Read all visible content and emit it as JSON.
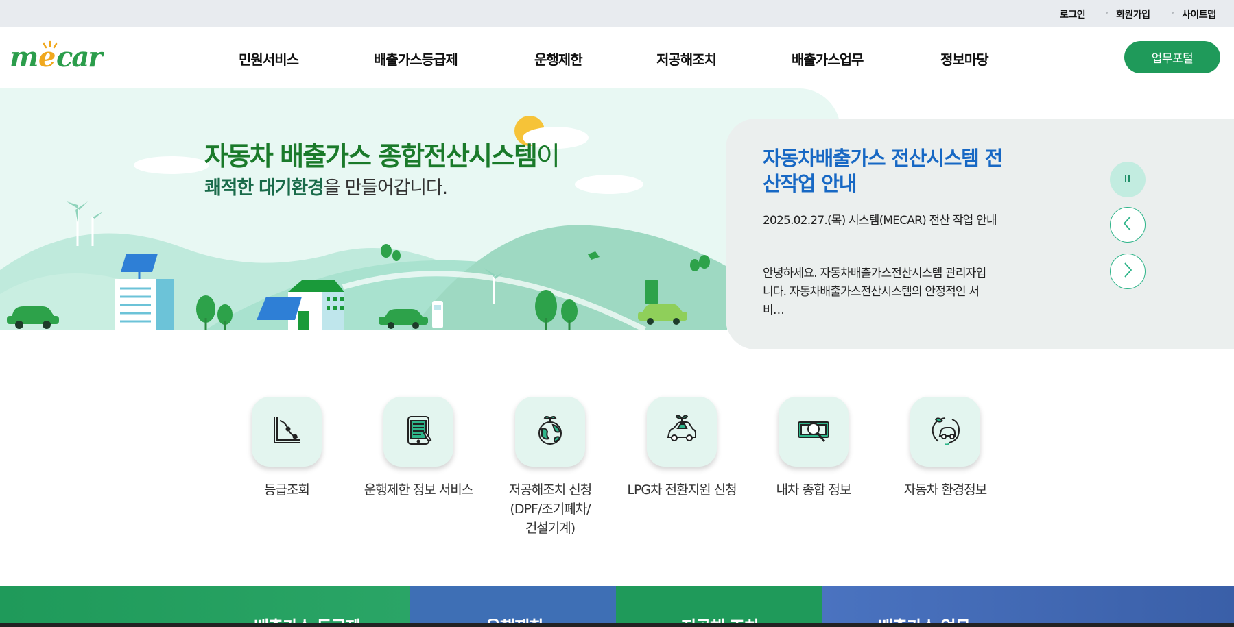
{
  "utility_nav": {
    "login": "로그인",
    "signup": "회원가입",
    "sitemap": "사이트맵"
  },
  "logo": {
    "text": "mecar"
  },
  "gnb": {
    "items": [
      {
        "label": "민원서비스"
      },
      {
        "label": "배출가스등급제"
      },
      {
        "label": "운행제한"
      },
      {
        "label": "저공해조치"
      },
      {
        "label": "배출가스업무"
      },
      {
        "label": "정보마당"
      }
    ],
    "portal_button": "업무포털"
  },
  "hero": {
    "title_bold": "자동차 배출가스 종합전산시스템",
    "title_suffix": "이",
    "subtitle_bold": "쾌적한 대기환경",
    "subtitle_rest": "을 만들어갑니다."
  },
  "notice": {
    "title": "자동차배출가스 전산시스템 전산작업 안내",
    "date_line": "2025.02.27.(목) 시스템(MECAR) 전산 작업 안내",
    "body": "안녕하세요. 자동차배출가스전산시스템 관리자입니다. 자동차배출가스전산시스템의 안정적인 서비…",
    "pause_icon": "pause-icon",
    "prev_icon": "chevron-left-icon",
    "next_icon": "chevron-right-icon"
  },
  "quick_menu": [
    {
      "label": "등급조회",
      "icon": "chart-curve-icon"
    },
    {
      "label": "운행제한 정보 서비스",
      "icon": "tablet-document-icon"
    },
    {
      "label": "저공해조치 신청\n(DPF/조기폐차/\n건설기계)",
      "icon": "earth-sprout-icon"
    },
    {
      "label": "LPG차 전환지원 신청",
      "icon": "eco-car-icon"
    },
    {
      "label": "내차 종합 정보",
      "icon": "money-search-icon"
    },
    {
      "label": "자동차 환경정보",
      "icon": "eco-circle-car-icon"
    }
  ],
  "bottom_banners": [
    {
      "label": "배출가스 등급제"
    },
    {
      "label": "운행제한"
    },
    {
      "label": "저공해 조치"
    },
    {
      "label": "배출가스 업무"
    }
  ],
  "colors": {
    "brand_green": "#1f9a5a",
    "hero_bg": "#e8f8f3",
    "notice_title": "#1768c4",
    "tile_bg": "#e3f5ef"
  }
}
